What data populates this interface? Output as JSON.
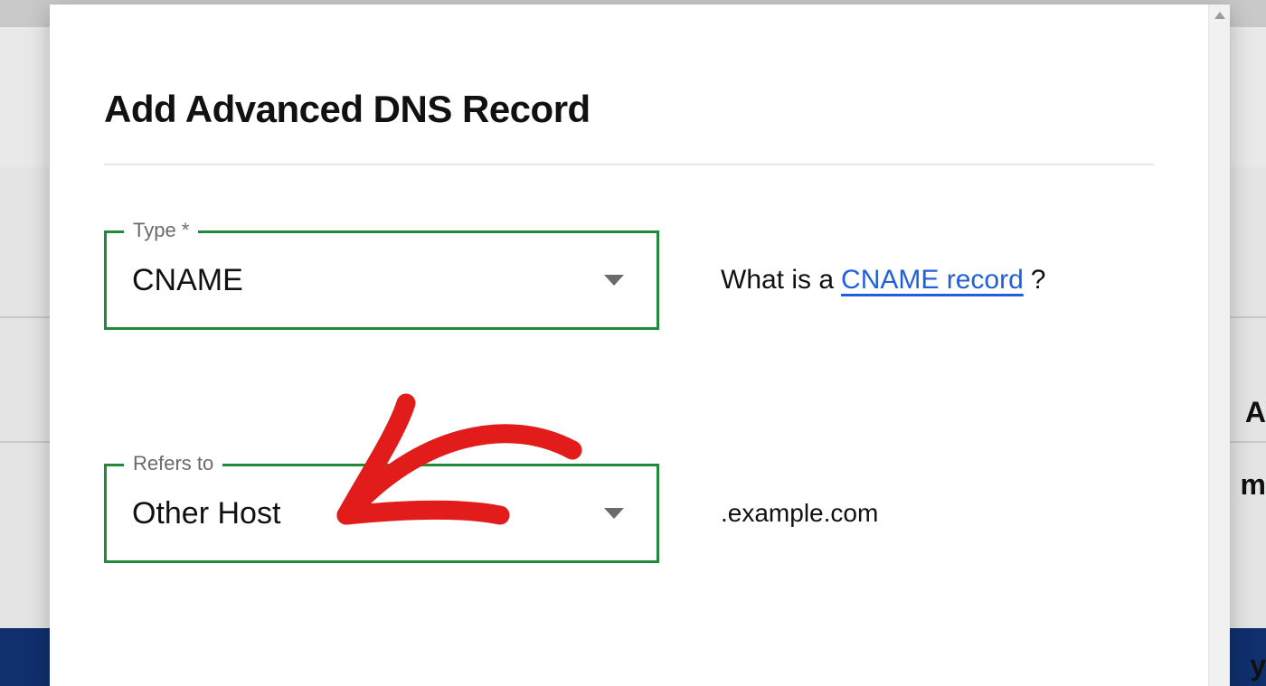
{
  "modal": {
    "title": "Add Advanced DNS Record",
    "fields": {
      "type": {
        "label": "Type *",
        "value": "CNAME"
      },
      "refers_to": {
        "label": "Refers to",
        "value": "Other Host"
      }
    },
    "help": {
      "prefix": "What is a ",
      "link_text": "CNAME record ",
      "suffix": "?"
    },
    "domain_suffix": ".example.com"
  },
  "background_text": {
    "line1": "A",
    "line2": "m",
    "line3": "y"
  }
}
